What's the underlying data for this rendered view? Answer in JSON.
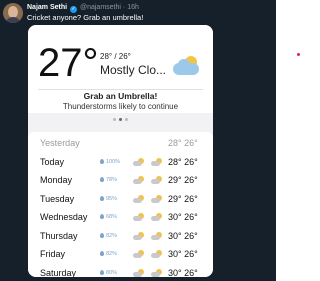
{
  "tweet": {
    "author_name": "Najam Sethi",
    "verified_mark": "✓",
    "handle": "@najamsethi",
    "separator": "·",
    "time": "16h",
    "text": "Cricket anyone? Grab an umbrella!",
    "background_color": "#15202b"
  },
  "weather": {
    "current_temp": "27°",
    "range": "28° / 26°",
    "condition": "Mostly Clo...",
    "condition_icon": "partly-cloudy-icon",
    "alert_title": "Grab an Umbrella!",
    "alert_body": "Thunderstorms likely to continue",
    "page_dots": 3,
    "active_dot": 2,
    "forecast": [
      {
        "day": "Yesterday",
        "precip": "",
        "temps": "28° 26°",
        "past": true
      },
      {
        "day": "Today",
        "precip": "100%",
        "temps": "28° 26°",
        "past": false
      },
      {
        "day": "Monday",
        "precip": "78%",
        "temps": "29° 26°",
        "past": false
      },
      {
        "day": "Tuesday",
        "precip": "95%",
        "temps": "29° 26°",
        "past": false
      },
      {
        "day": "Wednesday",
        "precip": "68%",
        "temps": "30° 26°",
        "past": false
      },
      {
        "day": "Thursday",
        "precip": "82%",
        "temps": "30° 26°",
        "past": false
      },
      {
        "day": "Friday",
        "precip": "82%",
        "temps": "30° 26°",
        "past": false
      },
      {
        "day": "Saturday",
        "precip": "80%",
        "temps": "30° 26°",
        "past": false
      }
    ]
  }
}
